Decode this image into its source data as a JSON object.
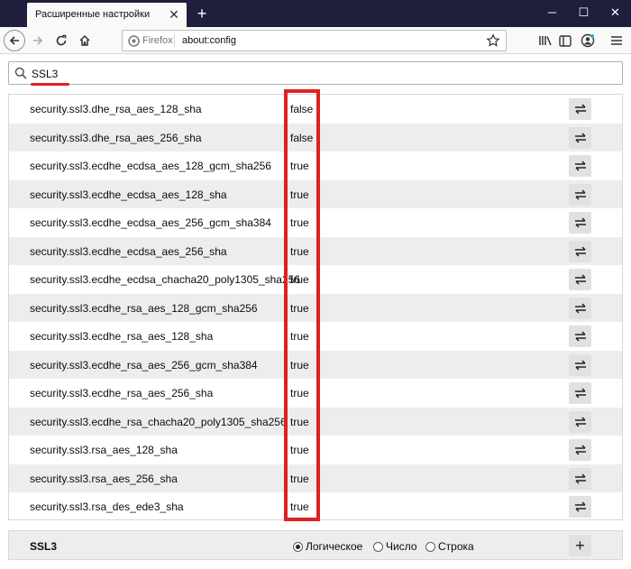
{
  "tab": {
    "title": "Расширенные настройки"
  },
  "window": {
    "minimize": "─",
    "maximize": "☐",
    "close": "✕"
  },
  "url": {
    "identity": "Firefox",
    "address": "about:config"
  },
  "search": {
    "value": "SSL3"
  },
  "prefs": [
    {
      "name": "security.ssl3.dhe_rsa_aes_128_sha",
      "value": "false"
    },
    {
      "name": "security.ssl3.dhe_rsa_aes_256_sha",
      "value": "false"
    },
    {
      "name": "security.ssl3.ecdhe_ecdsa_aes_128_gcm_sha256",
      "value": "true"
    },
    {
      "name": "security.ssl3.ecdhe_ecdsa_aes_128_sha",
      "value": "true"
    },
    {
      "name": "security.ssl3.ecdhe_ecdsa_aes_256_gcm_sha384",
      "value": "true"
    },
    {
      "name": "security.ssl3.ecdhe_ecdsa_aes_256_sha",
      "value": "true"
    },
    {
      "name": "security.ssl3.ecdhe_ecdsa_chacha20_poly1305_sha256",
      "value": "true"
    },
    {
      "name": "security.ssl3.ecdhe_rsa_aes_128_gcm_sha256",
      "value": "true"
    },
    {
      "name": "security.ssl3.ecdhe_rsa_aes_128_sha",
      "value": "true"
    },
    {
      "name": "security.ssl3.ecdhe_rsa_aes_256_gcm_sha384",
      "value": "true"
    },
    {
      "name": "security.ssl3.ecdhe_rsa_aes_256_sha",
      "value": "true"
    },
    {
      "name": "security.ssl3.ecdhe_rsa_chacha20_poly1305_sha256",
      "value": "true"
    },
    {
      "name": "security.ssl3.rsa_aes_128_sha",
      "value": "true"
    },
    {
      "name": "security.ssl3.rsa_aes_256_sha",
      "value": "true"
    },
    {
      "name": "security.ssl3.rsa_des_ede3_sha",
      "value": "true"
    }
  ],
  "add": {
    "name": "SSL3",
    "types": [
      "Логическое",
      "Число",
      "Строка"
    ],
    "selected": "Логическое",
    "add_label": "+"
  },
  "colors": {
    "highlight": "#e02020",
    "titlebar": "#1f1e3c",
    "row_alt": "#ededf0"
  },
  "icons": [
    "back-arrow-icon",
    "forward-arrow-icon",
    "reload-icon",
    "home-icon",
    "firefox-icon",
    "star-icon",
    "library-icon",
    "sidebar-icon",
    "account-icon",
    "menu-icon",
    "search-icon",
    "toggle-icon"
  ]
}
